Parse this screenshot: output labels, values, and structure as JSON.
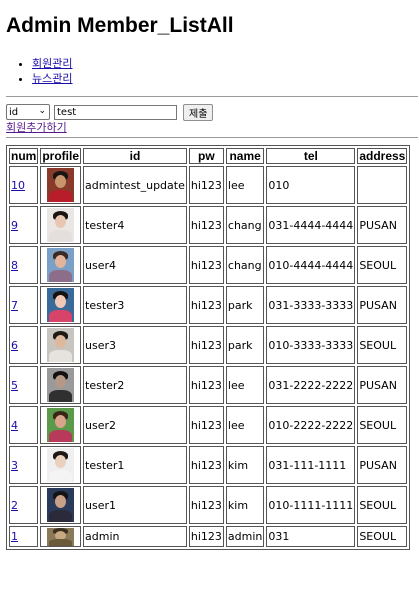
{
  "page_title": "Admin Member_ListAll",
  "nav": [
    {
      "label": "회원관리"
    },
    {
      "label": "뉴스관리"
    }
  ],
  "search": {
    "select_value": "id",
    "query": "test",
    "submit_label": "제출"
  },
  "add_member_label": "회원추가하기",
  "table": {
    "headers": [
      "num",
      "profile",
      "id",
      "pw",
      "name",
      "tel",
      "address"
    ],
    "rows": [
      {
        "num": "10",
        "id": "admintest_update",
        "pw": "hi123",
        "name": "lee",
        "tel": "010",
        "address": ""
      },
      {
        "num": "9",
        "id": "tester4",
        "pw": "hi123",
        "name": "chang",
        "tel": "031-4444-4444",
        "address": "PUSAN"
      },
      {
        "num": "8",
        "id": "user4",
        "pw": "hi123",
        "name": "chang",
        "tel": "010-4444-4444",
        "address": "SEOUL"
      },
      {
        "num": "7",
        "id": "tester3",
        "pw": "hi123",
        "name": "park",
        "tel": "031-3333-3333",
        "address": "PUSAN"
      },
      {
        "num": "6",
        "id": "user3",
        "pw": "hi123",
        "name": "park",
        "tel": "010-3333-3333",
        "address": "SEOUL"
      },
      {
        "num": "5",
        "id": "tester2",
        "pw": "hi123",
        "name": "lee",
        "tel": "031-2222-2222",
        "address": "PUSAN"
      },
      {
        "num": "4",
        "id": "user2",
        "pw": "hi123",
        "name": "lee",
        "tel": "010-2222-2222",
        "address": "SEOUL"
      },
      {
        "num": "3",
        "id": "tester1",
        "pw": "hi123",
        "name": "kim",
        "tel": "031-111-1111",
        "address": "PUSAN"
      },
      {
        "num": "2",
        "id": "user1",
        "pw": "hi123",
        "name": "kim",
        "tel": "010-1111-1111",
        "address": "SEOUL"
      },
      {
        "num": "1",
        "id": "admin",
        "pw": "hi123",
        "name": "admin",
        "tel": "031",
        "address": "SEOUL"
      }
    ]
  },
  "profile_photos": [
    {
      "bg": "#8a3a2a",
      "hair": "#1b1410",
      "face": "#c9956f",
      "body": "#b81e2a"
    },
    {
      "bg": "#e9e6e4",
      "hair": "#1a1512",
      "face": "#e8c6b2",
      "body": "#e4dfdc"
    },
    {
      "bg": "#7aa0c8",
      "hair": "#3b2a22",
      "face": "#e3b49c",
      "body": "#8d6e8a"
    },
    {
      "bg": "#3a6a9a",
      "hair": "#17120f",
      "face": "#f0c8b8",
      "body": "#d8436a"
    },
    {
      "bg": "#c8c4c0",
      "hair": "#1d1915",
      "face": "#deb89c",
      "body": "#e6e2de"
    },
    {
      "bg": "#9a9a9a",
      "hair": "#121212",
      "face": "#b49888",
      "body": "#303030"
    },
    {
      "bg": "#5a9a4a",
      "hair": "#3a2418",
      "face": "#d8a48c",
      "body": "#b83a5a"
    },
    {
      "bg": "#efefef",
      "hair": "#201814",
      "face": "#ecd0be",
      "body": "#f4f4f4"
    },
    {
      "bg": "#2a3a5a",
      "hair": "#141414",
      "face": "#c9a088",
      "body": "#2a2a3a"
    },
    {
      "bg": "#8a7a5a",
      "hair": "#3a3020",
      "face": "#c8a880",
      "body": "#6a5a3a"
    }
  ]
}
